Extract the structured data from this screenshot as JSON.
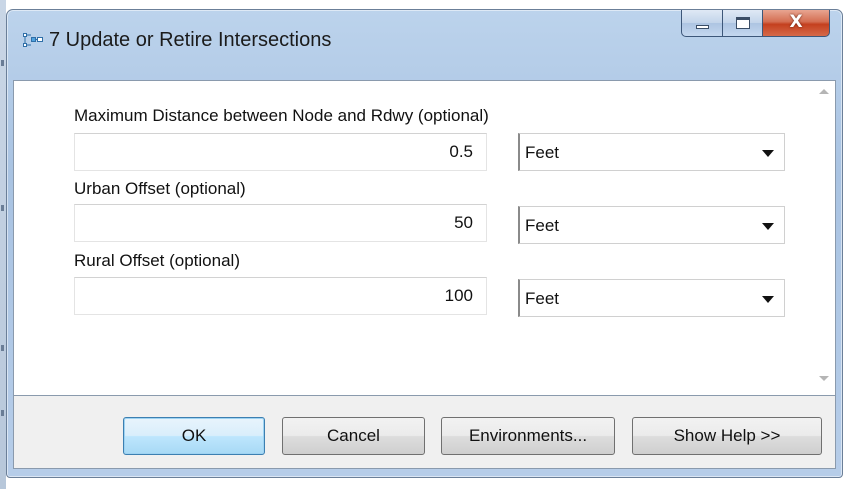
{
  "window": {
    "title": "7 Update or Retire Intersections",
    "icon": "toolbox-tool-icon",
    "caption_buttons": {
      "close_glyph": "X"
    }
  },
  "fields": [
    {
      "label": "Maximum Distance between Node and Rdwy (optional)",
      "value": "0.5",
      "unit": "Feet"
    },
    {
      "label": "Urban Offset (optional)",
      "value": "50",
      "unit": "Feet"
    },
    {
      "label": "Rural Offset (optional)",
      "value": "100",
      "unit": "Feet"
    }
  ],
  "buttons": {
    "ok": "OK",
    "cancel": "Cancel",
    "environments": "Environments...",
    "show_help": "Show Help >>"
  },
  "colors": {
    "default_button_border": "#3c7fb1",
    "close_button": "#c4401f",
    "frame": "#a9c3e2"
  }
}
